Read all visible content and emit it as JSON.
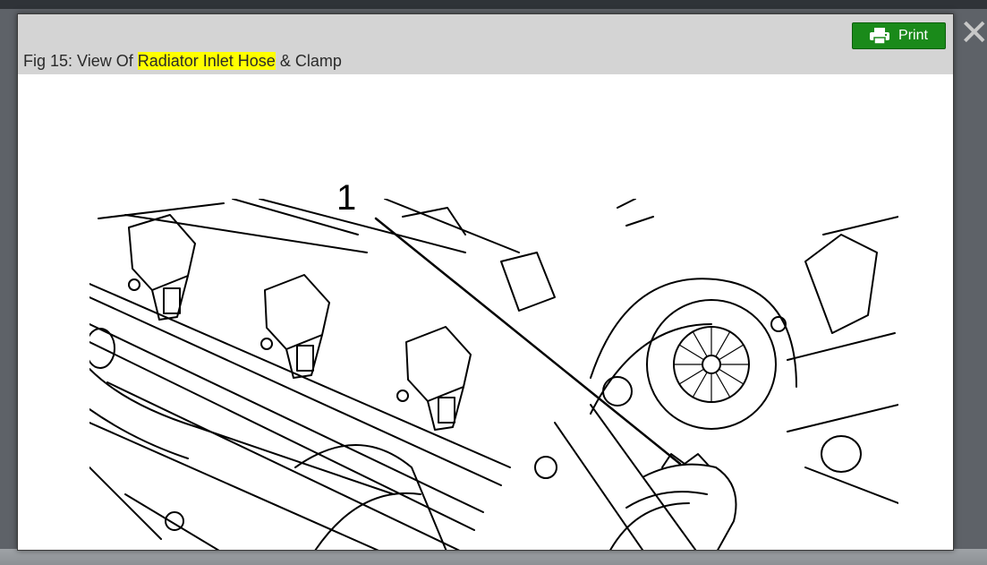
{
  "dialog": {
    "caption_prefix": "Fig 15: View Of ",
    "caption_highlight": "Radiator Inlet Hose",
    "caption_suffix": " & Clamp",
    "print_label": "Print",
    "close_symbol": "✕",
    "highlight_color": "#ffff00",
    "print_button_color": "#1a8a1a"
  },
  "figure": {
    "callout_label": "1"
  },
  "icons": {
    "print": "printer-icon",
    "close": "close-icon"
  }
}
